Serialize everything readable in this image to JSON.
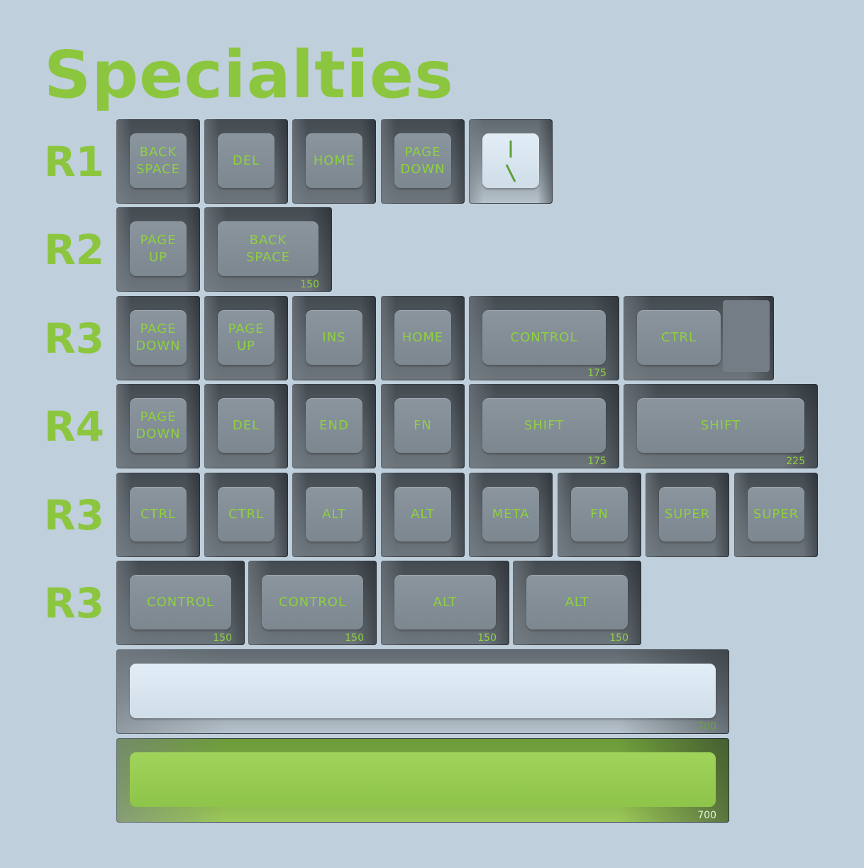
{
  "title": "Specialties",
  "row_labels": [
    "R1",
    "R2",
    "R3",
    "R4",
    "R3",
    "R3"
  ],
  "colors": {
    "accent": "#8cc63f",
    "background": "#bfcfdc",
    "keycap": "#7c8790"
  },
  "rows": [
    [
      {
        "legend": "BACK\nSPACE"
      },
      {
        "legend": "DEL"
      },
      {
        "legend": "HOME"
      },
      {
        "legend": "PAGE\nDOWN"
      },
      {
        "legend": "",
        "icon": "clock-icon",
        "style": "light"
      }
    ],
    [
      {
        "legend": "PAGE\nUP"
      },
      {
        "legend": "BACK\nSPACE",
        "size": "150"
      }
    ],
    [
      {
        "legend": "PAGE\nDOWN"
      },
      {
        "legend": "PAGE\nUP"
      },
      {
        "legend": "INS"
      },
      {
        "legend": "HOME"
      },
      {
        "legend": "CONTROL",
        "size": "175"
      },
      {
        "legend": "CTRL",
        "style": "stepped"
      }
    ],
    [
      {
        "legend": "PAGE\nDOWN"
      },
      {
        "legend": "DEL"
      },
      {
        "legend": "END"
      },
      {
        "legend": "FN"
      },
      {
        "legend": "SHIFT",
        "size": "175"
      },
      {
        "legend": "SHIFT",
        "size": "225"
      }
    ],
    [
      {
        "legend": "CTRL"
      },
      {
        "legend": "CTRL"
      },
      {
        "legend": "ALT"
      },
      {
        "legend": "ALT"
      },
      {
        "legend": "META"
      },
      {
        "legend": "FN"
      },
      {
        "legend": "SUPER"
      },
      {
        "legend": "SUPER"
      }
    ],
    [
      {
        "legend": "CONTROL",
        "size": "150"
      },
      {
        "legend": "CONTROL",
        "size": "150"
      },
      {
        "legend": "ALT",
        "size": "150"
      },
      {
        "legend": "ALT",
        "size": "150"
      }
    ],
    [
      {
        "legend": "",
        "size": "700",
        "style": "light"
      }
    ],
    [
      {
        "legend": "",
        "size": "700",
        "style": "green"
      }
    ]
  ]
}
